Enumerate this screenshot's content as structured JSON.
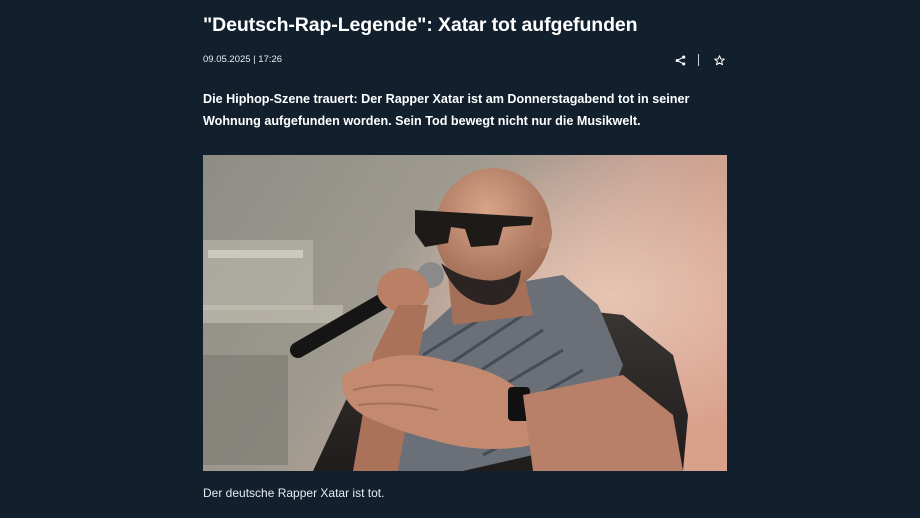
{
  "article": {
    "title": "\"Deutsch-Rap-Legende\": Xatar tot aufgefunden",
    "date": "09.05.2025 | 17:26",
    "lead": "Die Hiphop-Szene trauert: Der Rapper Xatar ist am Donnerstagabend tot in seiner Wohnung aufgefunden worden. Sein Tod bewegt nicht nur die Musikwelt.",
    "caption": "Der deutsche Rapper Xatar ist tot."
  },
  "actions": {
    "share_icon": "share-icon",
    "bookmark_icon": "star-icon"
  },
  "colors": {
    "background": "#12202e",
    "text": "#ffffff",
    "meta_text": "#e6ebf0"
  }
}
